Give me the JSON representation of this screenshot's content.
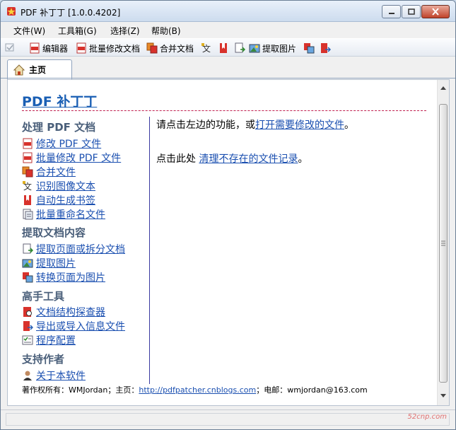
{
  "window": {
    "title": "PDF 补丁丁 [1.0.0.4202]"
  },
  "menu": [
    {
      "label": "文件(W)"
    },
    {
      "label": "工具箱(G)"
    },
    {
      "label": "选择(Z)"
    },
    {
      "label": "帮助(B)"
    }
  ],
  "toolbar": {
    "editor": "编辑器",
    "batch_modify": "批量修改文档",
    "merge": "合并文档",
    "extract_images": "提取图片"
  },
  "tabs": [
    {
      "label": "主页"
    }
  ],
  "home": {
    "title": "PDF 补丁丁",
    "sections": [
      {
        "heading": "处理 PDF 文档",
        "items": [
          {
            "label": "修改 PDF 文件",
            "icon": "pdf-edit-icon"
          },
          {
            "label": "批量修改 PDF 文件",
            "icon": "pdf-batch-icon"
          },
          {
            "label": "合并文件",
            "icon": "merge-icon"
          },
          {
            "label": "识别图像文本",
            "icon": "ocr-icon"
          },
          {
            "label": "自动生成书签",
            "icon": "bookmark-icon"
          },
          {
            "label": "批量重命名文件",
            "icon": "rename-icon"
          }
        ]
      },
      {
        "heading": "提取文档内容",
        "items": [
          {
            "label": "提取页面或拆分文档",
            "icon": "extract-pages-icon"
          },
          {
            "label": "提取图片",
            "icon": "extract-images-icon"
          },
          {
            "label": "转换页面为图片",
            "icon": "convert-icon"
          }
        ]
      },
      {
        "heading": "高手工具",
        "items": [
          {
            "label": "文档结构探查器",
            "icon": "inspector-icon"
          },
          {
            "label": "导出或导入信息文件",
            "icon": "export-icon"
          },
          {
            "label": "程序配置",
            "icon": "config-icon"
          }
        ]
      },
      {
        "heading": "支持作者",
        "items": [
          {
            "label": "关于本软件",
            "icon": "user-icon"
          }
        ]
      }
    ],
    "main_line1_prefix": "请点击左边的功能，或",
    "main_line1_link": "打开需要修改的文件",
    "main_line1_suffix": "。",
    "main_line2_prefix": "点击此处 ",
    "main_line2_link": "清理不存在的文件记录",
    "main_line2_suffix": "。",
    "footer_prefix": "著作权所有：WMJordan；主页：",
    "footer_link": "http://pdfpatcher.cnblogs.com",
    "footer_suffix": "；电邮：wmjordan@163.com"
  },
  "watermark": "52cnp.com",
  "colors": {
    "link": "#1a4fb0",
    "title": "#1a5fb4",
    "section": "#4a5f7a",
    "rule": "#c02050"
  }
}
